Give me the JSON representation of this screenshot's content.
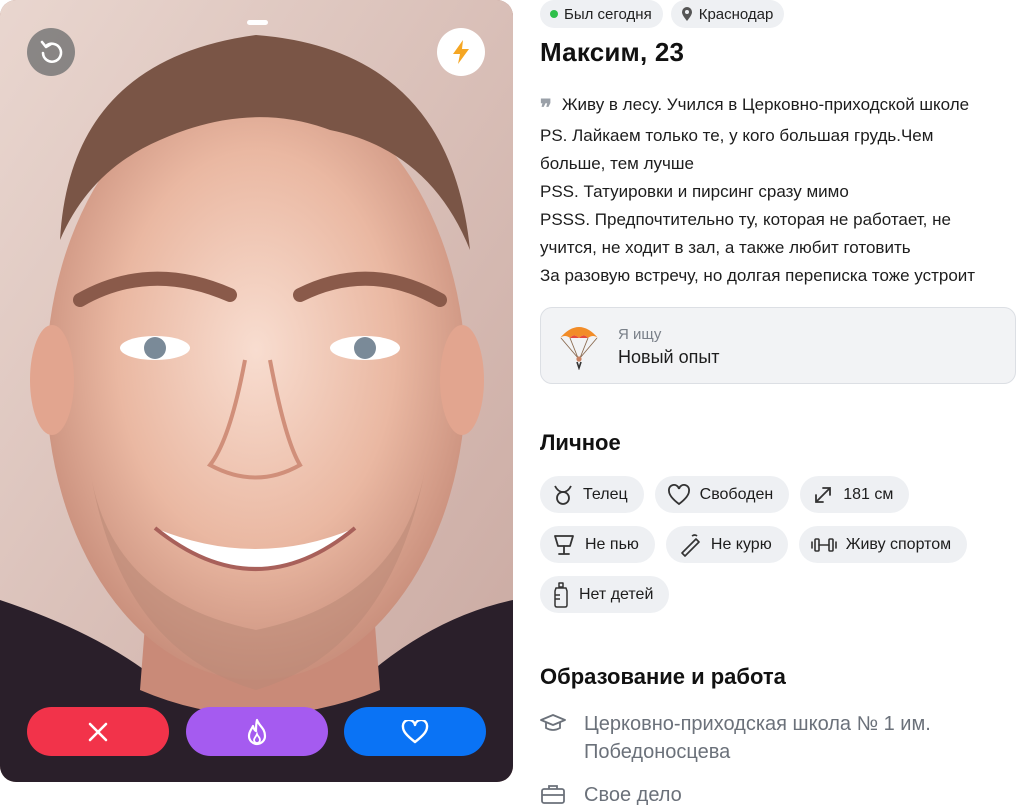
{
  "photo": {
    "undo_icon": "undo-icon",
    "boost_icon": "lightning-icon",
    "actions": {
      "dislike_icon": "close-icon",
      "superlike_icon": "flame-icon",
      "like_icon": "heart-icon"
    },
    "colors": {
      "dislike": "#f2334a",
      "superlike": "#a55bf0",
      "like": "#0a73f5"
    }
  },
  "profile": {
    "status": "Был сегодня",
    "city": "Краснодар",
    "name": "Максим, 23",
    "bio": [
      "Живу в лесу. Учился в Церковно-приходской школе",
      "PS. Лайкаем только те, у кого большая грудь.Чем",
      "больше, тем лучше",
      "PSS. Татуировки и пирсинг сразу мимо",
      "PSSS. Предпочтительно ту, которая не работает, не",
      "учится, не ходит в зал, а также любит готовить",
      "За разовую встречу, но долгая переписка тоже устроит"
    ],
    "seeking": {
      "label": "Я ищу",
      "value": "Новый опыт",
      "icon": "parachute-icon"
    },
    "personal_title": "Личное",
    "traits": [
      {
        "label": "Телец",
        "icon": "taurus-icon"
      },
      {
        "label": "Свободен",
        "icon": "heart-outline-icon"
      },
      {
        "label": "181 см",
        "icon": "height-icon"
      },
      {
        "label": "Не пью",
        "icon": "glass-icon"
      },
      {
        "label": "Не курю",
        "icon": "no-smoking-icon"
      },
      {
        "label": "Живу спортом",
        "icon": "dumbbell-icon"
      },
      {
        "label": "Нет детей",
        "icon": "baby-bottle-icon"
      }
    ],
    "education_title": "Образование и работа",
    "education": [
      {
        "text_1": "Церковно-приходская школа № 1 им.",
        "text_2": "Победоносцева",
        "icon": "graduation-cap-icon"
      },
      {
        "text_1": "Свое дело",
        "icon": "briefcase-icon"
      }
    ]
  }
}
